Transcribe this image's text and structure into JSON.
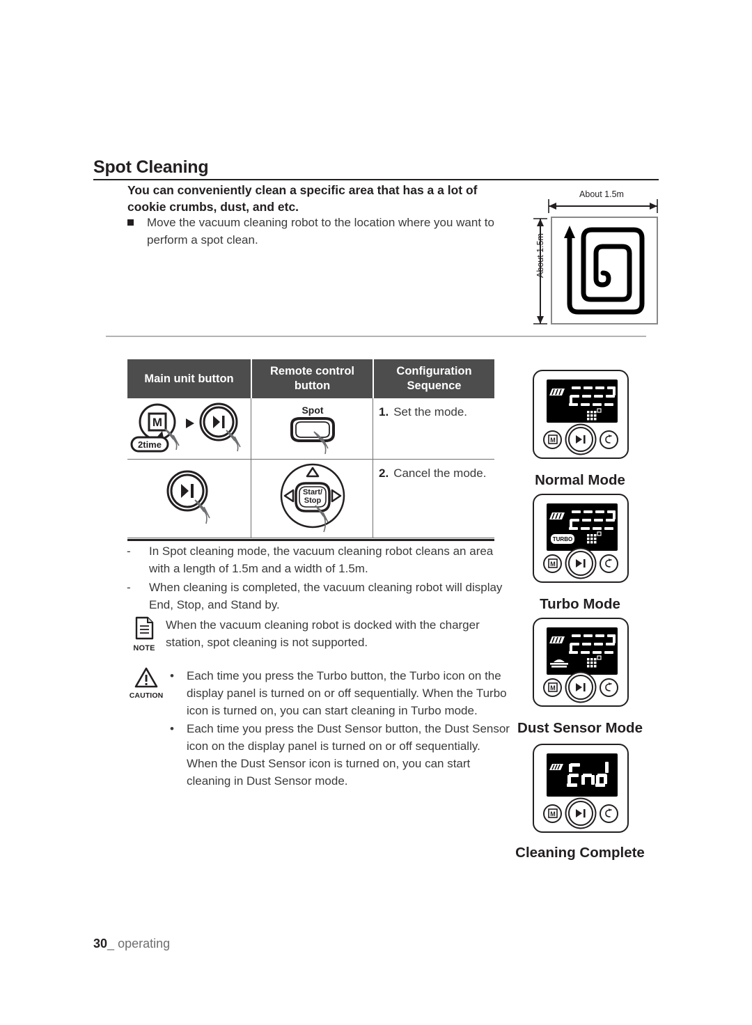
{
  "section": {
    "title": "Spot Cleaning",
    "lede": "You can conveniently clean a specific area that has a a lot of cookie crumbs, dust, and etc.",
    "bullet": "Move the vacuum cleaning robot to the location where you want to perform a spot clean."
  },
  "figure": {
    "top_label": "About 1.5m",
    "left_label": "About 1.5m",
    "icon": "spiral-path-icon"
  },
  "table": {
    "headers": [
      "Main unit button",
      "Remote control button",
      "Configuration Sequence"
    ],
    "rows": [
      {
        "main_unit": {
          "button_1": "M",
          "badge": "2time",
          "arrow": "play-arrow-icon",
          "button_2": "start-stop-icon"
        },
        "remote": {
          "label": "Spot",
          "icon": "spot-button-icon"
        },
        "sequence_number": "1.",
        "sequence_text": "Set the mode."
      },
      {
        "main_unit": {
          "button_1": "start-stop-icon"
        },
        "remote": {
          "label": "Start/ Stop",
          "label_line1": "Start/",
          "label_line2": "Stop",
          "icon": "dpad-start-stop-icon"
        },
        "sequence_number": "2.",
        "sequence_text": "Cancel the mode."
      }
    ]
  },
  "dash_notes": [
    {
      "marker": "-",
      "text": "In Spot cleaning mode, the vacuum cleaning robot cleans an area with a length of 1.5m and a width of 1.5m."
    },
    {
      "marker": "-",
      "text": "When cleaning is completed, the vacuum cleaning robot will display End, Stop, and Stand by."
    }
  ],
  "note": {
    "icon": "note-document-icon",
    "label": "NOTE",
    "text": "When the vacuum cleaning robot is docked with the charger station, spot cleaning is not supported."
  },
  "caution": {
    "icon": "warning-triangle-icon",
    "label": "CAUTION",
    "bullets": [
      "Each time you press the Turbo button, the Turbo icon on the display panel is turned on or off sequentially. When the Turbo icon is turned on, you can start cleaning in Turbo mode.",
      "Each time you press the Dust Sensor button, the Dust Sensor icon on the display panel is turned on or off sequentially. When the Dust Sensor icon is turned on, you can start cleaning in Dust Sensor mode."
    ]
  },
  "panels": [
    {
      "caption": "Normal Mode",
      "lcd": {
        "battery_icon": "battery-full-icon",
        "digits": "----",
        "mode_icon": null,
        "grid_icon": "dust-grid-icon"
      },
      "buttons": [
        "mode-button-m",
        "start-stop-button",
        "recharge-button"
      ]
    },
    {
      "caption": "Turbo Mode",
      "lcd": {
        "battery_icon": "battery-full-icon",
        "digits": "----",
        "mode_icon": "TURBO",
        "grid_icon": "dust-grid-icon"
      },
      "buttons": [
        "mode-button-m",
        "start-stop-button",
        "recharge-button"
      ]
    },
    {
      "caption": "Dust Sensor Mode",
      "lcd": {
        "battery_icon": "battery-full-icon",
        "digits": "----",
        "mode_icon": "dust-sensor-icon",
        "grid_icon": "dust-grid-icon"
      },
      "buttons": [
        "mode-button-m",
        "start-stop-button",
        "recharge-button"
      ]
    },
    {
      "caption": "Cleaning Complete",
      "lcd": {
        "battery_icon": "battery-full-icon",
        "digits": "End",
        "mode_icon": null,
        "grid_icon": null
      },
      "buttons": [
        "mode-button-m",
        "start-stop-button",
        "recharge-button"
      ]
    }
  ],
  "footer": {
    "page_number": "30",
    "separator": "_",
    "label": "operating"
  }
}
